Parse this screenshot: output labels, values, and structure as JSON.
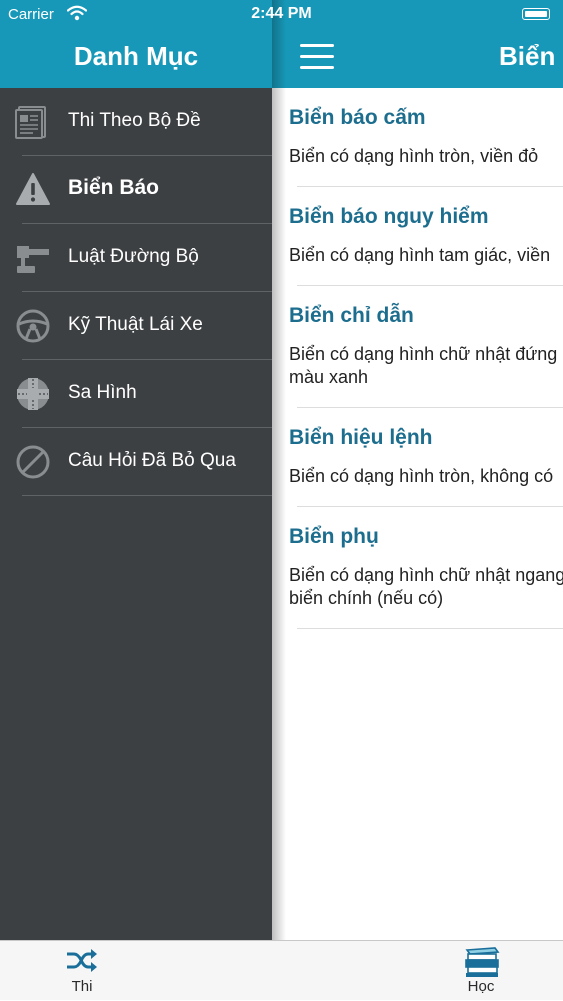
{
  "status_bar": {
    "carrier": "Carrier",
    "time": "2:44 PM"
  },
  "drawer": {
    "title": "Danh Mục",
    "items": [
      {
        "label": "Thi Theo Bộ Đề",
        "icon": "newspaper-icon"
      },
      {
        "label": "Biển Báo",
        "icon": "warning-icon",
        "active": true
      },
      {
        "label": "Luật Đường Bộ",
        "icon": "gavel-icon"
      },
      {
        "label": "Kỹ Thuật Lái Xe",
        "icon": "steering-wheel-icon"
      },
      {
        "label": "Sa Hình",
        "icon": "road-intersection-icon"
      },
      {
        "label": "Câu Hỏi Đã Bỏ Qua",
        "icon": "prohibited-icon"
      }
    ]
  },
  "main": {
    "title": "Biển b",
    "sections": [
      {
        "title": "Biển báo cấm",
        "desc": [
          "Biển có dạng hình tròn, viền đỏ"
        ]
      },
      {
        "title": "Biển báo nguy hiểm",
        "desc": [
          "Biển có dạng hình tam giác, viền"
        ]
      },
      {
        "title": "Biển chỉ dẫn",
        "desc": [
          "Biển có dạng hình chữ nhật đứng",
          "màu xanh"
        ]
      },
      {
        "title": "Biển hiệu lệnh",
        "desc": [
          "Biển có dạng hình tròn, không có"
        ]
      },
      {
        "title": "Biển phụ",
        "desc": [
          "Biển có dạng hình chữ nhật ngang",
          "biển chính (nếu có)"
        ]
      }
    ]
  },
  "tab_bar": {
    "tabs": [
      {
        "label": "Thi",
        "icon": "shuffle-icon"
      },
      {
        "label": "Học",
        "icon": "books-icon"
      }
    ]
  },
  "colors": {
    "accent": "#1798b8",
    "drawer_bg": "#3d4043",
    "section_title": "#1d6e8e"
  }
}
